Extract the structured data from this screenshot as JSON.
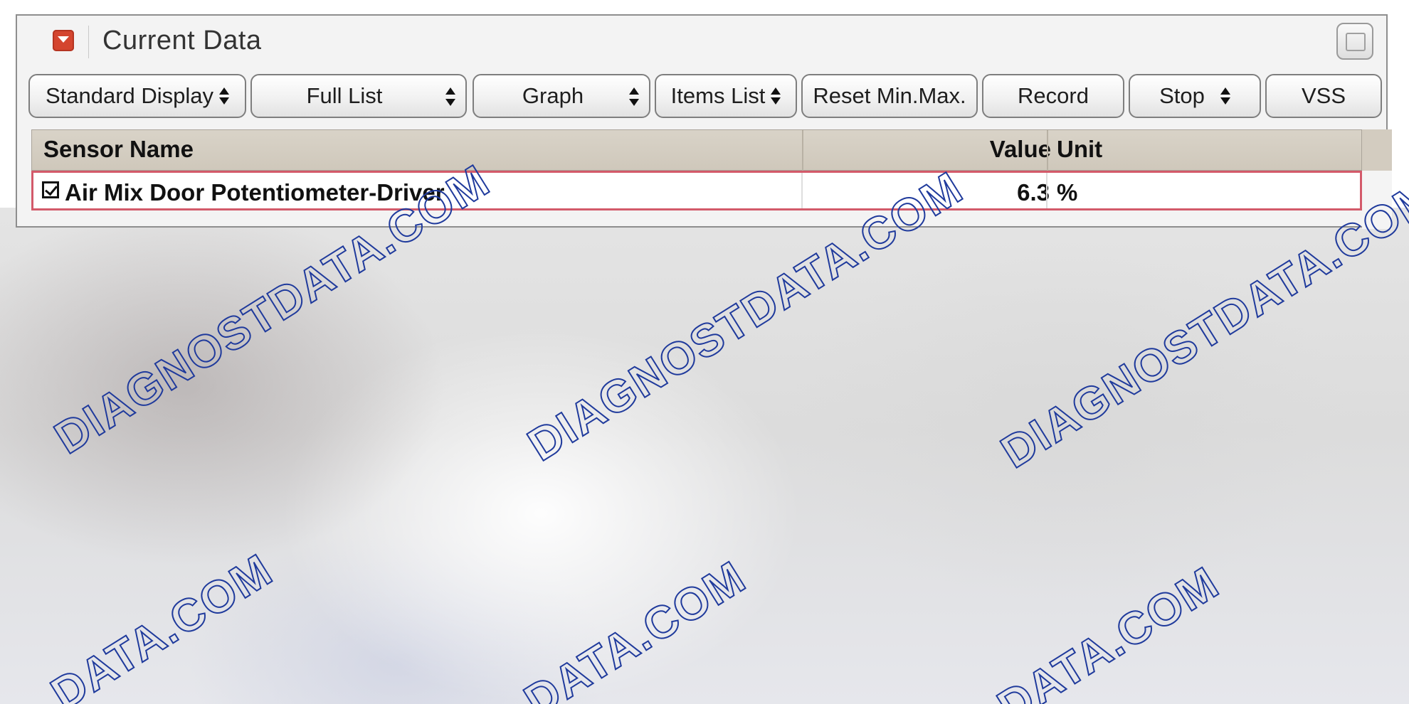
{
  "panel": {
    "title": "Current Data",
    "collapse_icon": "collapse-arrow-icon",
    "maximize_icon": "maximize-window-icon"
  },
  "toolbar": {
    "standard_display": "Standard Display",
    "full_list": "Full List",
    "graph": "Graph",
    "items_list": "Items List",
    "reset_min_max": "Reset Min.Max.",
    "record": "Record",
    "stop": "Stop",
    "vss": "VSS"
  },
  "table": {
    "columns": {
      "sensor_name": "Sensor Name",
      "value": "Value",
      "unit": "Unit"
    },
    "rows": [
      {
        "checked": true,
        "sensor_name": "Air Mix Door Potentiometer-Driver",
        "value": "6.3",
        "unit": "%"
      }
    ]
  },
  "watermark": {
    "text": "DIAGNOSTDATA.COM",
    "partial_text": "DATA.COM",
    "color": "#1f3a9c"
  },
  "colors": {
    "selected_row_border": "#d35a6a",
    "collapse_button": "#d4452f",
    "header_bg": "#d9d3c8"
  }
}
